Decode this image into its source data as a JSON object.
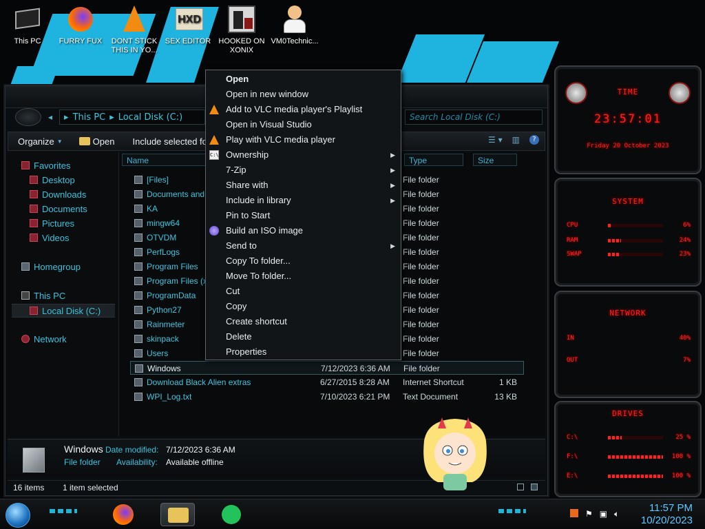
{
  "desktop": {
    "icons": [
      {
        "label": "This PC"
      },
      {
        "label": "FURRY FUX"
      },
      {
        "label": "DONT STICK THIS IN YO..."
      },
      {
        "label": "SEX EDITOR"
      },
      {
        "label": "HOOKED ON XONIX"
      },
      {
        "label": "VM0Technic..."
      }
    ]
  },
  "explorer": {
    "address": {
      "segments": [
        "This PC",
        "Local Disk (C:)"
      ]
    },
    "search": {
      "placeholder": "Search Local Disk (C:)"
    },
    "toolbar": {
      "organize": "Organize",
      "open": "Open",
      "include": "Include selected folder"
    },
    "nav": {
      "favorites": "Favorites",
      "desktop": "Desktop",
      "downloads": "Downloads",
      "documents": "Documents",
      "pictures": "Pictures",
      "videos": "Videos",
      "homegroup": "Homegroup",
      "this_pc": "This PC",
      "local_disk": "Local Disk (C:)",
      "network": "Network"
    },
    "columns": {
      "name": "Name",
      "type": "Type",
      "size": "Size"
    },
    "files": [
      {
        "name": "[Files]",
        "date": "",
        "type": "File folder",
        "size": ""
      },
      {
        "name": "Documents and Settings",
        "date": "",
        "type": "File folder",
        "size": ""
      },
      {
        "name": "KA",
        "date": "",
        "type": "File folder",
        "size": ""
      },
      {
        "name": "mingw64",
        "date": "",
        "type": "File folder",
        "size": ""
      },
      {
        "name": "OTVDM",
        "date": "",
        "type": "File folder",
        "size": ""
      },
      {
        "name": "PerfLogs",
        "date": "",
        "type": "File folder",
        "size": ""
      },
      {
        "name": "Program Files",
        "date": "",
        "type": "File folder",
        "size": ""
      },
      {
        "name": "Program Files (x86)",
        "date": "",
        "type": "File folder",
        "size": ""
      },
      {
        "name": "ProgramData",
        "date": "",
        "type": "File folder",
        "size": ""
      },
      {
        "name": "Python27",
        "date": "",
        "type": "File folder",
        "size": ""
      },
      {
        "name": "Rainmeter",
        "date": "",
        "type": "File folder",
        "size": ""
      },
      {
        "name": "skinpack",
        "date": "",
        "type": "File folder",
        "size": ""
      },
      {
        "name": "Users",
        "date": "",
        "type": "File folder",
        "size": ""
      },
      {
        "name": "Windows",
        "date": "7/12/2023 6:36 AM",
        "type": "File folder",
        "size": ""
      },
      {
        "name": "Download Black Alien extras",
        "date": "6/27/2015 8:28 AM",
        "type": "Internet Shortcut",
        "size": "1 KB"
      },
      {
        "name": "WPI_Log.txt",
        "date": "7/10/2023 6:21 PM",
        "type": "Text Document",
        "size": "13 KB"
      }
    ],
    "details": {
      "name": "Windows",
      "modified_label": "Date modified:",
      "modified_value": "7/12/2023 6:36 AM",
      "type": "File folder",
      "availability_label": "Availability:",
      "availability_value": "Available offline"
    },
    "status": {
      "count": "16 items",
      "selected": "1 item selected"
    }
  },
  "context_menu": {
    "items": [
      {
        "label": "Open"
      },
      {
        "label": "Open in new window"
      },
      {
        "label": "Add to VLC media player's Playlist"
      },
      {
        "label": "Open in Visual Studio"
      },
      {
        "label": "Play with VLC media player"
      },
      {
        "label": "Ownership"
      },
      {
        "label": "7-Zip"
      },
      {
        "label": "Share with"
      },
      {
        "label": "Include in library"
      },
      {
        "label": "Pin to Start"
      },
      {
        "label": "Build an ISO image"
      },
      {
        "label": "Send to"
      },
      {
        "label": "Copy To folder..."
      },
      {
        "label": "Move To folder..."
      },
      {
        "label": "Cut"
      },
      {
        "label": "Copy"
      },
      {
        "label": "Create shortcut"
      },
      {
        "label": "Delete"
      },
      {
        "label": "Properties"
      }
    ]
  },
  "widgets": {
    "time": {
      "title": "TIME",
      "clock": "23:57:01",
      "date": "Friday 20 October 2023"
    },
    "system": {
      "title": "SYSTEM",
      "cpu_label": "CPU",
      "cpu_value": "6%",
      "cpu_pct": 6,
      "ram_label": "RAM",
      "ram_value": "24%",
      "ram_pct": 24,
      "swap_label": "SWAP",
      "swap_value": "23%",
      "swap_pct": 23
    },
    "network": {
      "title": "NETWORK",
      "in_label": "IN",
      "in_value": "40%",
      "out_label": "OUT",
      "out_value": "7%"
    },
    "drives": {
      "title": "DRIVES",
      "items": [
        {
          "label": "C:\\",
          "value": "25 %",
          "pct": 25
        },
        {
          "label": "F:\\",
          "value": "100 %",
          "pct": 100
        },
        {
          "label": "E:\\",
          "value": "100 %",
          "pct": 100
        }
      ]
    }
  },
  "taskbar": {
    "time": "11:57 PM",
    "date": "10/20/2023"
  },
  "colors": {
    "accent": "#39c3dc",
    "widget_red": "#ff2020",
    "taskbar_clock": "#5fc9ff"
  }
}
